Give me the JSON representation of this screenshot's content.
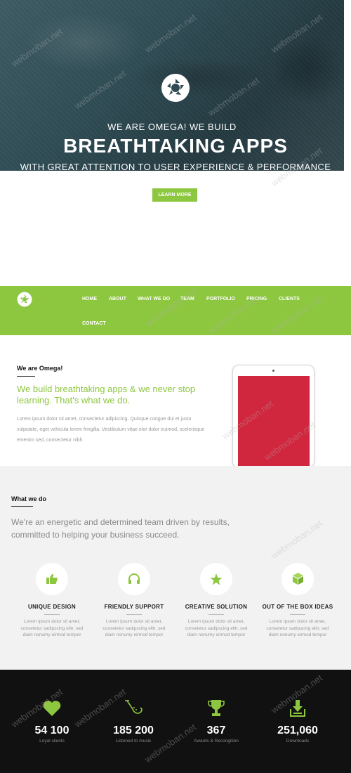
{
  "hero": {
    "kicker": "WE ARE OMEGA! WE BUILD",
    "title": "BREATHTAKING APPS",
    "subtitle": "WITH GREAT ATTENTION TO USER EXPERIENCE & PERFORMANCE",
    "cta_label": "LEARN MORE",
    "logo_icon": "aperture-icon"
  },
  "nav": {
    "logo_icon": "aperture-icon",
    "items": [
      "HOME",
      "ABOUT",
      "WHAT WE DO",
      "TEAM",
      "PORTFOLIO",
      "PRICING",
      "CLIENTS",
      "CONTACT"
    ]
  },
  "about": {
    "heading": "We are Omega!",
    "lead": "We build breathtaking apps & we never stop learning. That's what we do.",
    "body": "Lorem ipsum dolor sit amet, consectetur adipiscing. Quisque congue dui et justo vulputate, eget vehicula lorem fringilla. Vestibulum vitae elor dolor euimod, scelerisque emenim sed, consectetur nibh."
  },
  "what_we_do": {
    "heading": "What we do",
    "lead": "We're an energetic and determined team driven by results, committed to helping your business succeed.",
    "features": [
      {
        "title": "UNIQUE DESIGN",
        "icon": "thumbs-up-icon",
        "text": "Lorem ipsum dolor sit amet, consetetur sadipscing elitr, sed diam nonumy eirmod tempor"
      },
      {
        "title": "FRIENDLY SUPPORT",
        "icon": "headphones-icon",
        "text": "Lorem ipsum dolor sit amet, consetetur sadipscing elitr, sed diam nonumy eirmod tempor"
      },
      {
        "title": "CREATIVE SOLUTION",
        "icon": "star-icon",
        "text": "Lorem ipsum dolor sit amet, consetetur sadipscing elitr, sed diam nonumy eirmod tempor"
      },
      {
        "title": "OUT OF THE BOX IDEAS",
        "icon": "cube-icon",
        "text": "Lorem ipsum dolor sit amet, consetetur sadipscing elitr, sed diam nonumy eirmod tempor"
      }
    ]
  },
  "stats": [
    {
      "number": "54 100",
      "label": "Loyal clients",
      "icon": "heart-icon"
    },
    {
      "number": "185 200",
      "label": "Listened to music",
      "icon": "saxophone-icon"
    },
    {
      "number": "367",
      "label": "Awards & Recongition",
      "icon": "trophy-icon"
    },
    {
      "number": "251,060",
      "label": "Downloads",
      "icon": "download-tray-icon"
    }
  ],
  "watermark": "webmoban.net",
  "colors": {
    "accent": "#8dc63f",
    "device_screen": "#d0263e",
    "dark": "#111111",
    "light_bg": "#f2f2f2"
  }
}
